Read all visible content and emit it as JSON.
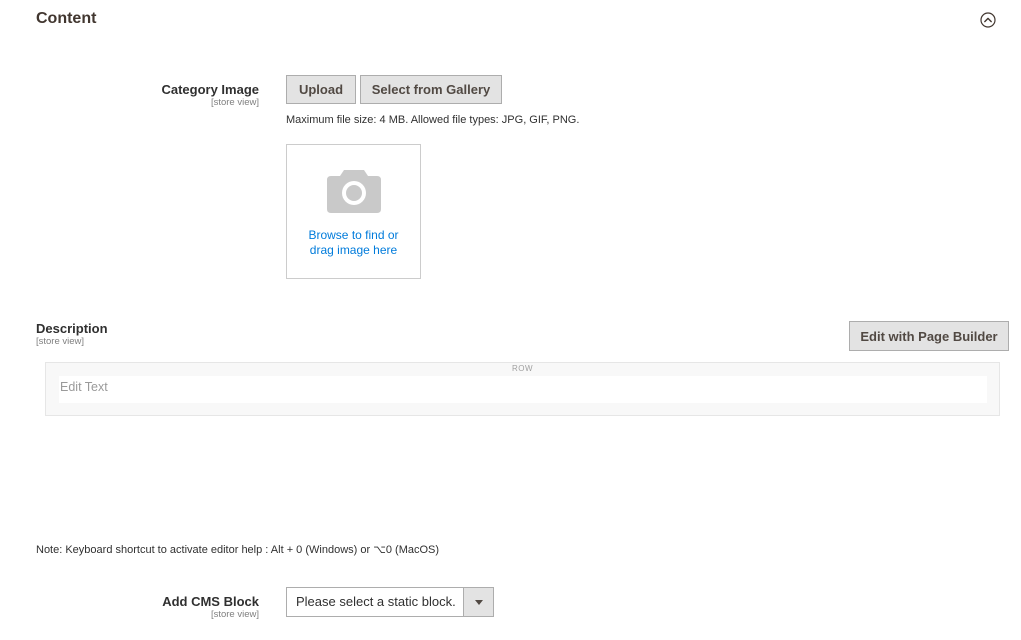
{
  "section": {
    "title": "Content"
  },
  "category_image": {
    "label": "Category Image",
    "scope": "[store view]",
    "upload_label": "Upload",
    "gallery_label": "Select from Gallery",
    "file_note": "Maximum file size: 4 MB. Allowed file types: JPG, GIF, PNG.",
    "dropzone_line1": "Browse to find or",
    "dropzone_line2": "drag image here"
  },
  "description": {
    "label": "Description",
    "scope": "[store view]",
    "page_builder_label": "Edit with Page Builder",
    "row_label": "ROW",
    "text_placeholder": "Edit Text",
    "shortcut_note": "Note: Keyboard shortcut to activate editor help : Alt + 0 (Windows) or ⌥0 (MacOS)"
  },
  "cms_block": {
    "label": "Add CMS Block",
    "scope": "[store view]",
    "selected_value": "Please select a static block."
  },
  "colors": {
    "link": "#007bdb",
    "button_bg": "#e3e3e3",
    "button_border": "#adadad",
    "title": "#41362f"
  },
  "icons": {
    "collapse": "chevron-up-circle-icon",
    "camera": "camera-icon",
    "dropdown": "triangle-down-icon"
  }
}
